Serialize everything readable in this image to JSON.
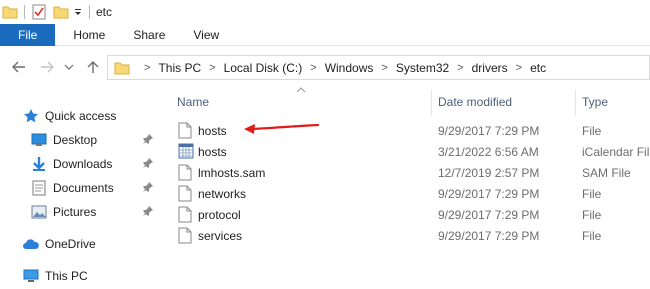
{
  "window": {
    "title": "etc"
  },
  "ribbon": {
    "tabs": [
      "File",
      "Home",
      "Share",
      "View"
    ]
  },
  "address": {
    "breadcrumbs": [
      "This PC",
      "Local Disk (C:)",
      "Windows",
      "System32",
      "drivers",
      "etc"
    ]
  },
  "sidebar": {
    "quick_access": "Quick access",
    "items": [
      {
        "label": "Desktop",
        "icon": "desktop-icon",
        "pinned": true
      },
      {
        "label": "Downloads",
        "icon": "downloads-icon",
        "pinned": true
      },
      {
        "label": "Documents",
        "icon": "documents-icon",
        "pinned": true
      },
      {
        "label": "Pictures",
        "icon": "pictures-icon",
        "pinned": true
      }
    ],
    "onedrive": "OneDrive",
    "this_pc": "This PC"
  },
  "columns": {
    "name": "Name",
    "date": "Date modified",
    "type": "Type"
  },
  "files": [
    {
      "name": "hosts",
      "date": "9/29/2017 7:29 PM",
      "type": "File",
      "icon": "file-icon"
    },
    {
      "name": "hosts",
      "date": "3/21/2022 6:56 AM",
      "type": "iCalendar File",
      "icon": "calendar-file-icon"
    },
    {
      "name": "lmhosts.sam",
      "date": "12/7/2019 2:57 PM",
      "type": "SAM File",
      "icon": "file-icon"
    },
    {
      "name": "networks",
      "date": "9/29/2017 7:29 PM",
      "type": "File",
      "icon": "file-icon"
    },
    {
      "name": "protocol",
      "date": "9/29/2017 7:29 PM",
      "type": "File",
      "icon": "file-icon"
    },
    {
      "name": "services",
      "date": "9/29/2017 7:29 PM",
      "type": "File",
      "icon": "file-icon"
    }
  ],
  "colors": {
    "file_tab": "#1a6bbd",
    "annotation_arrow": "#e01b1b",
    "column_header": "#4c607a"
  }
}
